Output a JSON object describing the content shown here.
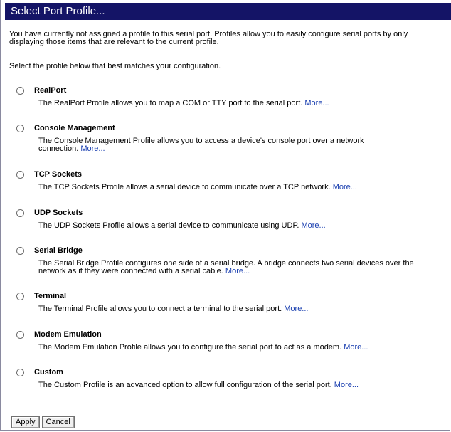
{
  "title": "Select Port Profile...",
  "intro": {
    "line1": "You have currently not assigned a profile to this serial port. Profiles allow you to easily configure serial ports by only",
    "line2": "displaying those items that are relevant to the current profile."
  },
  "select_text": "Select the profile below that best matches your configuration.",
  "more_label": "More...",
  "options": [
    {
      "title": "RealPort",
      "desc1": "The RealPort Profile allows you to map a COM or TTY port to the serial port.",
      "desc2": ""
    },
    {
      "title": "Console Management",
      "desc1": "The Console Management Profile allows you to access a device's console port over a network",
      "desc2": "connection."
    },
    {
      "title": "TCP Sockets",
      "desc1": "The TCP Sockets Profile allows a serial device to communicate over a TCP network.",
      "desc2": ""
    },
    {
      "title": "UDP Sockets",
      "desc1": "The UDP Sockets Profile allows a serial device to communicate using UDP.",
      "desc2": ""
    },
    {
      "title": "Serial Bridge",
      "desc1": "The Serial Bridge Profile configures one side of a serial bridge. A bridge connects two serial devices over the",
      "desc2": "network as if they were connected with a serial cable."
    },
    {
      "title": "Terminal",
      "desc1": "The Terminal Profile allows you to connect a terminal to the serial port.",
      "desc2": ""
    },
    {
      "title": "Modem Emulation",
      "desc1": "The Modem Emulation Profile allows you to configure the serial port to act as a modem.",
      "desc2": ""
    },
    {
      "title": "Custom",
      "desc1": "The Custom Profile is an advanced option to allow full configuration of the serial port.",
      "desc2": ""
    }
  ],
  "buttons": {
    "apply": "Apply",
    "cancel": "Cancel"
  }
}
